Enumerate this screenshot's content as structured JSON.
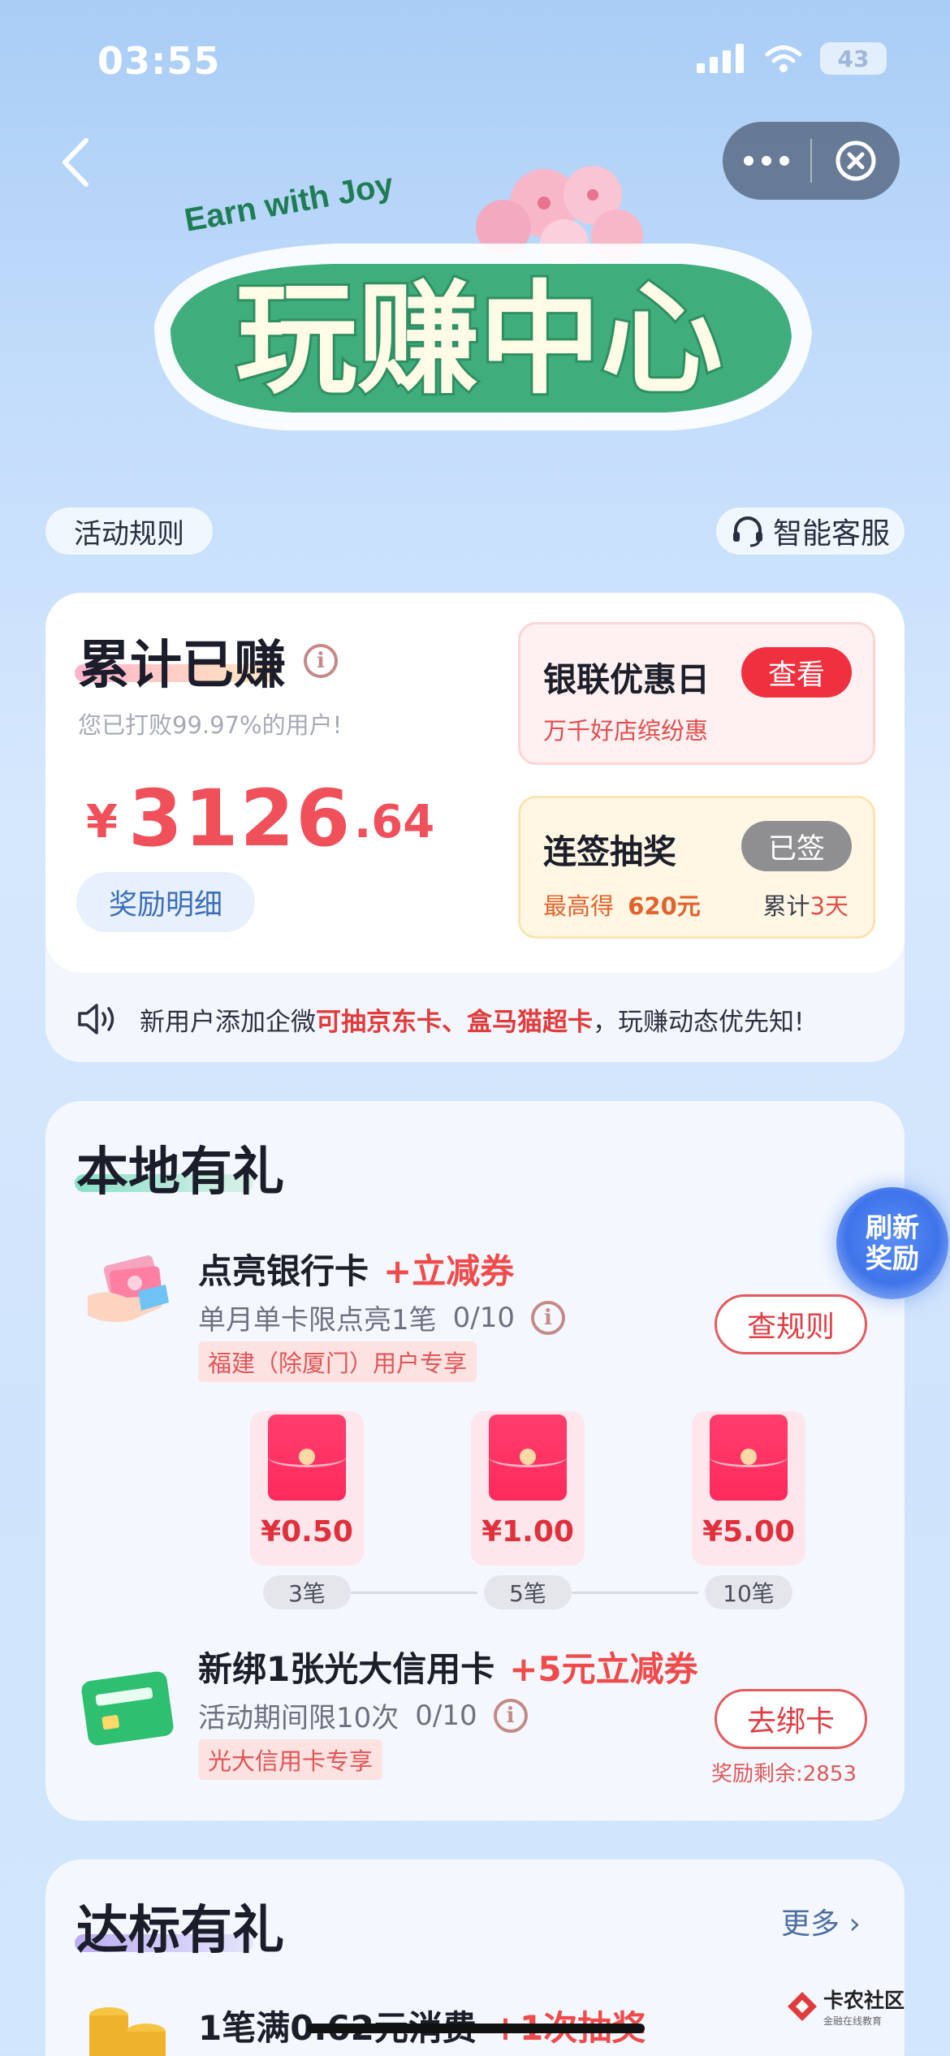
{
  "status_bar": {
    "time": "03:55",
    "battery": "43"
  },
  "banner": {
    "subtitle": "Earn with Joy",
    "title": "玩赚中心"
  },
  "top_links": {
    "rules": "活动规则",
    "service": "智能客服"
  },
  "earnings": {
    "title": "累计已赚",
    "info_icon": "i",
    "subtitle": "您已打败99.97%的用户!",
    "currency": "¥",
    "amount_integer": "3126",
    "amount_decimal": ".64",
    "detail_button": "奖励明细"
  },
  "unionpay_day": {
    "title": "银联优惠日",
    "subtitle": "万千好店缤纷惠",
    "button": "查看"
  },
  "sign_in": {
    "title": "连签抽奖",
    "max_label": "最高得",
    "max_value": "620元",
    "streak_prefix": "累计",
    "streak_value": "3天",
    "button": "已签"
  },
  "notice": {
    "prefix": "新用户添加企微",
    "highlight": "可抽京东卡、盒马猫超卡",
    "suffix": "，玩赚动态优先知!"
  },
  "local_gifts": {
    "title": "本地有礼",
    "refresh_badge": {
      "line1": "刷新",
      "line2": "奖励"
    },
    "task1": {
      "title": "点亮银行卡",
      "reward": "+立减券",
      "limit": "单月单卡限点亮1笔",
      "progress": "0/10",
      "tag": "福建（除厦门）用户专享",
      "button": "查规则",
      "tiers": [
        {
          "value": "¥0.50",
          "step": "3笔"
        },
        {
          "value": "¥1.00",
          "step": "5笔"
        },
        {
          "value": "¥5.00",
          "step": "10笔"
        }
      ]
    },
    "task2": {
      "title": "新绑1张光大信用卡",
      "reward": "+5元立减券",
      "limit": "活动期间限10次",
      "progress": "0/10",
      "tag": "光大信用卡专享",
      "button": "去绑卡",
      "remaining": "奖励剩余:2853"
    }
  },
  "reach_gifts": {
    "title": "达标有礼",
    "more": "更多",
    "task1": {
      "title": "1笔满0.62元消费",
      "reward": "+1次抽奖"
    }
  },
  "watermark": {
    "name": "卡农社区",
    "tagline": "金融在线教育"
  },
  "colors": {
    "accent_red": "#f0505a",
    "link_blue": "#3a6fb8",
    "bg_blue": "#c2dcfb"
  }
}
